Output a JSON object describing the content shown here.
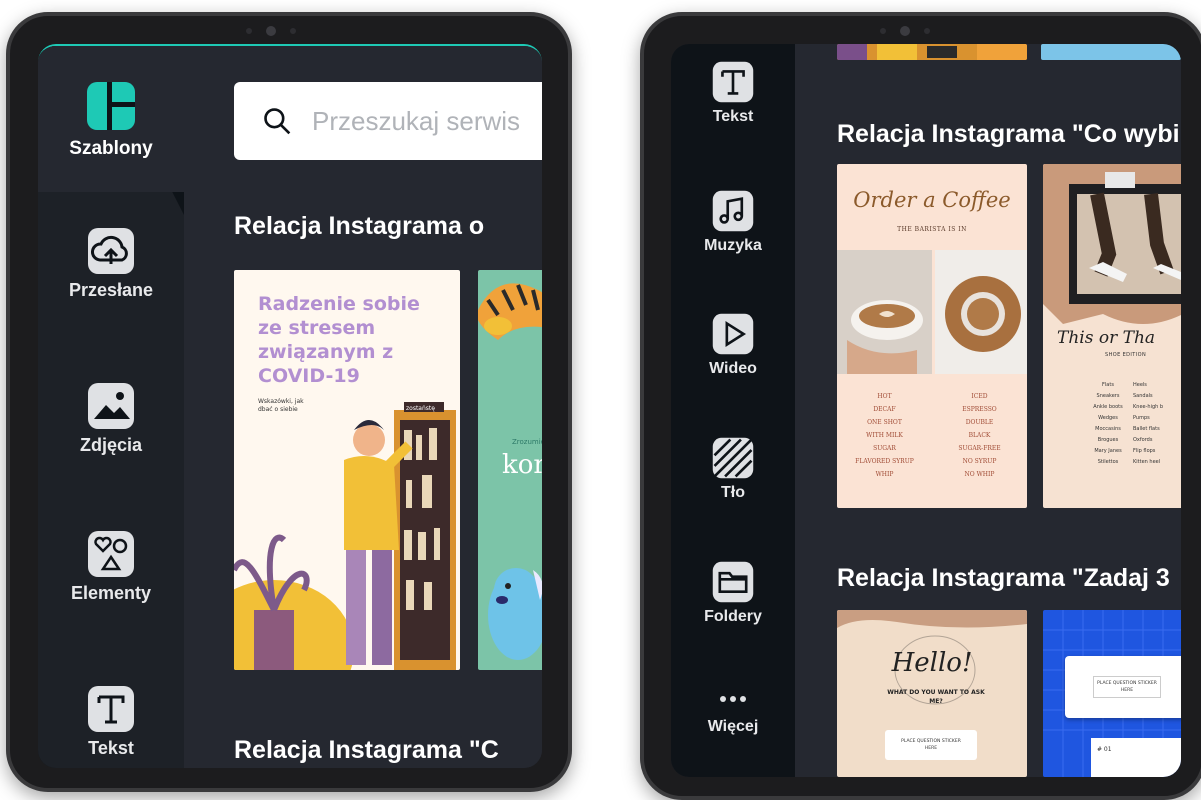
{
  "left": {
    "sidebar": {
      "active": {
        "label": "Szablony",
        "icon": "templates-icon"
      },
      "items": [
        {
          "label": "Przesłane",
          "icon": "upload-cloud-icon"
        },
        {
          "label": "Zdjęcia",
          "icon": "image-icon"
        },
        {
          "label": "Elementy",
          "icon": "shapes-icon"
        },
        {
          "label": "Tekst",
          "icon": "text-icon"
        }
      ]
    },
    "search": {
      "placeholder": "Przeszukaj serwis"
    },
    "sections": [
      {
        "title": "Relacja Instagrama o"
      },
      {
        "title": "Relacja Instagrama \"C"
      }
    ],
    "card_covid": {
      "title": "Radzenie sobie ze stresem związanym z COVID-19",
      "subtitle": "Wskazówki, jak dbać o siebie",
      "book_label": "zostaństę"
    },
    "card_kids": {
      "small": "Zrozumieć",
      "big": "kor"
    }
  },
  "right": {
    "sidebar": {
      "items": [
        {
          "label": "Tekst",
          "icon": "text-icon"
        },
        {
          "label": "Muzyka",
          "icon": "music-note-icon"
        },
        {
          "label": "Wideo",
          "icon": "play-icon"
        },
        {
          "label": "Tło",
          "icon": "background-pattern-icon"
        },
        {
          "label": "Foldery",
          "icon": "folder-icon"
        },
        {
          "label": "Więcej",
          "icon": "more-dots-icon"
        }
      ]
    },
    "sections": [
      {
        "title": "Relacja Instagrama \"Co wybi"
      },
      {
        "title": "Relacja Instagrama \"Zadaj 3"
      }
    ],
    "card_coffee": {
      "title": "Order a Coffee",
      "subtitle": "THE BARISTA IS IN",
      "col1": [
        "HOT",
        "DECAF",
        "ONE SHOT",
        "WITH MILK",
        "SUGAR",
        "FLAVORED SYRUP",
        "WHIP"
      ],
      "col2": [
        "ICED",
        "ESPRESSO",
        "DOUBLE",
        "BLACK",
        "SUGAR-FREE",
        "NO SYRUP",
        "NO WHIP"
      ]
    },
    "card_shoe": {
      "title": "This or Tha",
      "subtitle": "SHOE EDITION",
      "col1": [
        "Flats",
        "Sneakers",
        "Ankle boots",
        "Wedges",
        "Moccasins",
        "Brogues",
        "Mary Janes",
        "Stilettos"
      ],
      "col2": [
        "Heels",
        "Sandals",
        "Knee-high b",
        "Pumps",
        "Ballet flats",
        "Oxfords",
        "Flip flops",
        "Kitten heel"
      ]
    },
    "card_hello": {
      "hello": "Hello!",
      "question": "WHAT DO YOU WANT TO ASK ME?",
      "sticker": "PLACE QUESTION STICKER HERE"
    },
    "card_blue": {
      "sticker": "PLACE QUESTION STICKER HERE",
      "num": "# 01"
    }
  },
  "colors": {
    "accent": "#1ec9b5",
    "sidebar": "#0e1318",
    "panel": "#252830"
  }
}
